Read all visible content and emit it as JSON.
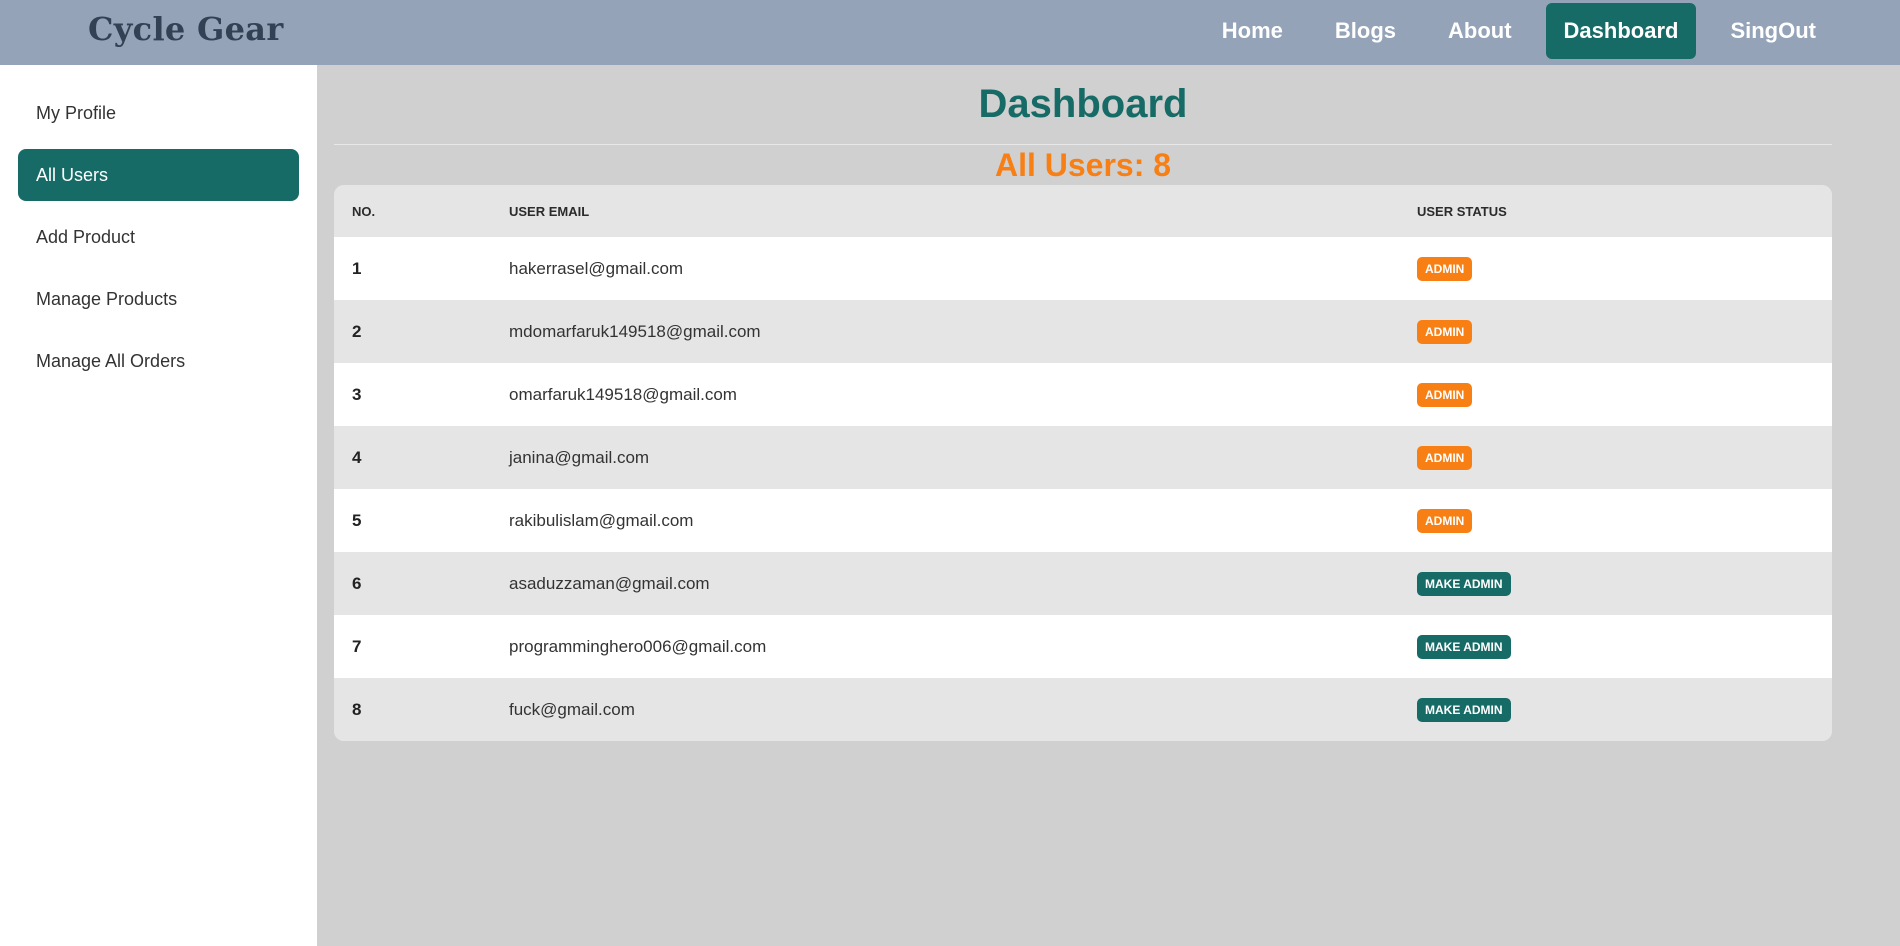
{
  "brand": "Cycle Gear",
  "nav": [
    {
      "label": "Home",
      "active": false
    },
    {
      "label": "Blogs",
      "active": false
    },
    {
      "label": "About",
      "active": false
    },
    {
      "label": "Dashboard",
      "active": true
    },
    {
      "label": "SingOut",
      "active": false
    }
  ],
  "sidebar": [
    {
      "label": "My Profile",
      "active": false
    },
    {
      "label": "All Users",
      "active": true
    },
    {
      "label": "Add Product",
      "active": false
    },
    {
      "label": "Manage Products",
      "active": false
    },
    {
      "label": "Manage All Orders",
      "active": false
    }
  ],
  "main": {
    "title": "Dashboard",
    "users_count_label": "All Users: 8"
  },
  "table": {
    "headers": [
      "No.",
      "User Email",
      "User Status"
    ],
    "rows": [
      {
        "no": "1",
        "email": "hakerrasel@gmail.com",
        "status": "admin"
      },
      {
        "no": "2",
        "email": "mdomarfaruk149518@gmail.com",
        "status": "admin"
      },
      {
        "no": "3",
        "email": "omarfaruk149518@gmail.com",
        "status": "admin"
      },
      {
        "no": "4",
        "email": "janina@gmail.com",
        "status": "admin"
      },
      {
        "no": "5",
        "email": "rakibulislam@gmail.com",
        "status": "admin"
      },
      {
        "no": "6",
        "email": "asaduzzaman@gmail.com",
        "status": "make admin"
      },
      {
        "no": "7",
        "email": "programminghero006@gmail.com",
        "status": "make admin"
      },
      {
        "no": "8",
        "email": "fuck@gmail.com",
        "status": "make admin"
      }
    ]
  },
  "colors": {
    "navbar": "#94a3b8",
    "accent": "#176b66",
    "orange": "#f77f14",
    "content_bg": "#d0d0d0"
  }
}
